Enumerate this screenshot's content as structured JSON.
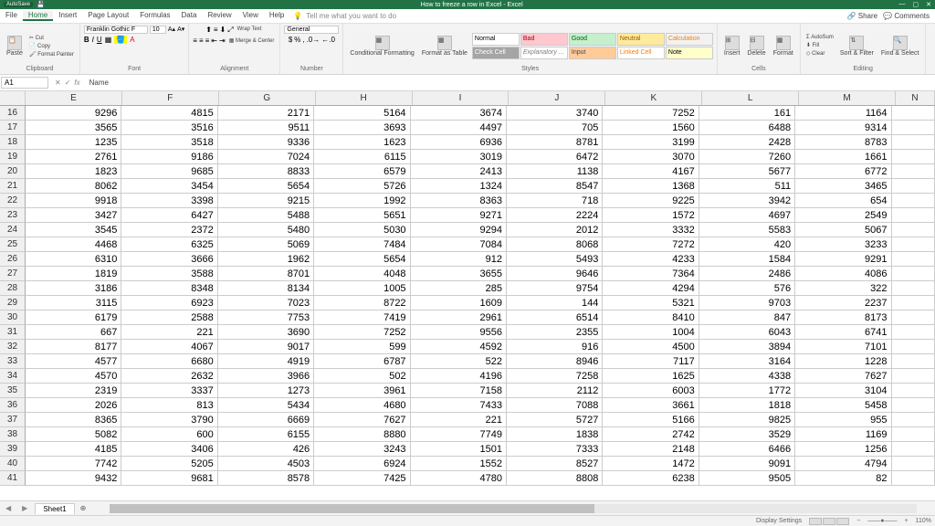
{
  "titlebar": {
    "autosave": "AutoSave",
    "title": "How to freeze a row in Excel - Excel"
  },
  "menubar": {
    "tabs": [
      "File",
      "Home",
      "Insert",
      "Page Layout",
      "Formulas",
      "Data",
      "Review",
      "View",
      "Help"
    ],
    "tellme": "Tell me what you want to do",
    "share": "Share",
    "comments": "Comments"
  },
  "ribbon": {
    "paste": "Paste",
    "cut": "Cut",
    "copy": "Copy",
    "format_painter": "Format Painter",
    "clipboard_label": "Clipboard",
    "font_name": "Franklin Gothic F",
    "font_size": "10",
    "font_label": "Font",
    "wrap_text": "Wrap Text",
    "merge_center": "Merge & Center",
    "alignment_label": "Alignment",
    "number_format": "General",
    "number_label": "Number",
    "cond_fmt": "Conditional Formatting",
    "fmt_table": "Format as Table",
    "styles": {
      "normal": "Normal",
      "bad": "Bad",
      "good": "Good",
      "neutral": "Neutral",
      "calc": "Calculation",
      "check": "Check Cell",
      "expl": "Explanatory ...",
      "input": "Input",
      "linked": "Linked Cell",
      "note": "Note"
    },
    "styles_label": "Styles",
    "insert": "Insert",
    "delete": "Delete",
    "format": "Format",
    "cells_label": "Cells",
    "autosum": "AutoSum",
    "fill": "Fill",
    "clear": "Clear",
    "sort_filter": "Sort & Filter",
    "find_select": "Find & Select",
    "editing_label": "Editing"
  },
  "namebox": {
    "ref": "A1",
    "formula": "Name"
  },
  "columns": [
    "E",
    "F",
    "G",
    "H",
    "I",
    "J",
    "K",
    "L",
    "M",
    "N"
  ],
  "row_start": 16,
  "data": [
    [
      9296,
      4815,
      2171,
      5164,
      3674,
      3740,
      7252,
      161,
      1164
    ],
    [
      3565,
      3516,
      9511,
      3693,
      4497,
      705,
      1560,
      6488,
      9314
    ],
    [
      1235,
      3518,
      9336,
      1623,
      6936,
      8781,
      3199,
      2428,
      8783
    ],
    [
      2761,
      9186,
      7024,
      6115,
      3019,
      6472,
      3070,
      7260,
      1661
    ],
    [
      1823,
      9685,
      8833,
      6579,
      2413,
      1138,
      4167,
      5677,
      6772
    ],
    [
      8062,
      3454,
      5654,
      5726,
      1324,
      8547,
      1368,
      511,
      3465
    ],
    [
      9918,
      3398,
      9215,
      1992,
      8363,
      718,
      9225,
      3942,
      654
    ],
    [
      3427,
      6427,
      5488,
      5651,
      9271,
      2224,
      1572,
      4697,
      2549
    ],
    [
      3545,
      2372,
      5480,
      5030,
      9294,
      2012,
      3332,
      5583,
      5067
    ],
    [
      4468,
      6325,
      5069,
      7484,
      7084,
      8068,
      7272,
      420,
      3233
    ],
    [
      6310,
      3666,
      1962,
      5654,
      912,
      5493,
      4233,
      1584,
      9291
    ],
    [
      1819,
      3588,
      8701,
      4048,
      3655,
      9646,
      7364,
      2486,
      4086
    ],
    [
      3186,
      8348,
      8134,
      1005,
      285,
      9754,
      4294,
      576,
      322
    ],
    [
      3115,
      6923,
      7023,
      8722,
      1609,
      144,
      5321,
      9703,
      2237
    ],
    [
      6179,
      2588,
      7753,
      7419,
      2961,
      6514,
      8410,
      847,
      8173
    ],
    [
      667,
      221,
      3690,
      7252,
      9556,
      2355,
      1004,
      6043,
      6741
    ],
    [
      8177,
      4067,
      9017,
      599,
      4592,
      916,
      4500,
      3894,
      7101
    ],
    [
      4577,
      6680,
      4919,
      6787,
      522,
      8946,
      7117,
      3164,
      1228
    ],
    [
      4570,
      2632,
      3966,
      502,
      4196,
      7258,
      1625,
      4338,
      7627
    ],
    [
      2319,
      3337,
      1273,
      3961,
      7158,
      2112,
      6003,
      1772,
      3104
    ],
    [
      2026,
      813,
      5434,
      4680,
      7433,
      7088,
      3661,
      1818,
      5458
    ],
    [
      8365,
      3790,
      6669,
      7627,
      221,
      5727,
      5166,
      9825,
      955
    ],
    [
      5082,
      600,
      6155,
      8880,
      7749,
      1838,
      2742,
      3529,
      1169
    ],
    [
      4185,
      3406,
      426,
      3243,
      1501,
      7333,
      2148,
      6466,
      1256
    ],
    [
      7742,
      5205,
      4503,
      6924,
      1552,
      8527,
      1472,
      9091,
      4794
    ],
    [
      9432,
      9681,
      8578,
      7425,
      4780,
      8808,
      6238,
      9505,
      82
    ]
  ],
  "sheet": {
    "name": "Sheet1"
  },
  "status": {
    "display": "Display Settings",
    "zoom": "110%"
  }
}
